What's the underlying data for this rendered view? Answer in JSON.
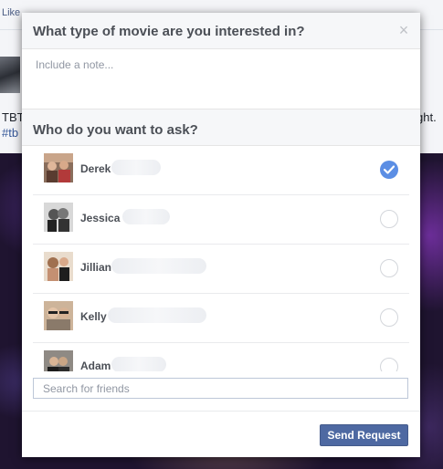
{
  "background": {
    "like_label": "Like",
    "post_text_start": "TBT",
    "post_tag_start": "#tb",
    "post_text_end": "ght."
  },
  "dialog": {
    "title": "What type of movie are you interested in?",
    "close_symbol": "×",
    "note_placeholder": "Include a note...",
    "ask_title": "Who do you want to ask?",
    "friends": [
      {
        "name": "Derek",
        "selected": true
      },
      {
        "name": "Jessica",
        "selected": false
      },
      {
        "name": "Jillian",
        "selected": false
      },
      {
        "name": "Kelly",
        "selected": false
      },
      {
        "name": "Adam",
        "selected": false
      }
    ],
    "search_placeholder": "Search for friends",
    "send_button": "Send Request"
  },
  "colors": {
    "brand_blue": "#4e69a2",
    "check_blue": "#5b8ee4"
  }
}
